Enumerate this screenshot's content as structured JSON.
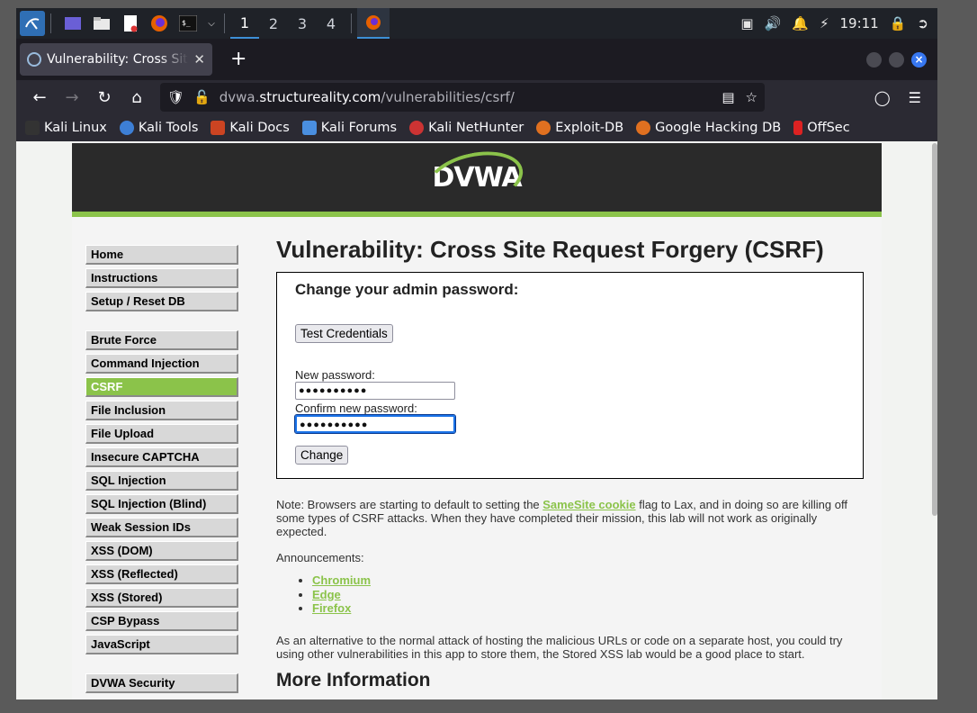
{
  "taskbar": {
    "workspaces": [
      "1",
      "2",
      "3",
      "4"
    ],
    "active_workspace": "1",
    "clock": "19:11"
  },
  "browser": {
    "tab_title": "Vulnerability: Cross Site Request Forgery (CSRF)",
    "url_prefix": "dvwa.",
    "url_host": "structureality.com",
    "url_path": "/vulnerabilities/csrf/",
    "bookmarks": [
      "Kali Linux",
      "Kali Tools",
      "Kali Docs",
      "Kali Forums",
      "Kali NetHunter",
      "Exploit-DB",
      "Google Hacking DB",
      "OffSec"
    ]
  },
  "dvwa": {
    "logo": "DVWA",
    "menu": {
      "home": "Home",
      "instructions": "Instructions",
      "setup": "Setup / Reset DB",
      "brute": "Brute Force",
      "cmd": "Command Injection",
      "csrf": "CSRF",
      "fi": "File Inclusion",
      "fu": "File Upload",
      "captcha": "Insecure CAPTCHA",
      "sqli": "SQL Injection",
      "sqlib": "SQL Injection (Blind)",
      "wsi": "Weak Session IDs",
      "xssd": "XSS (DOM)",
      "xssr": "XSS (Reflected)",
      "xsss": "XSS (Stored)",
      "csp": "CSP Bypass",
      "js": "JavaScript",
      "sec": "DVWA Security"
    },
    "page_title": "Vulnerability: Cross Site Request Forgery (CSRF)",
    "form": {
      "heading": "Change your admin password:",
      "test_button": "Test Credentials",
      "new_label": "New password:",
      "new_value": "●●●●●●●●●●",
      "confirm_label": "Confirm new password:",
      "confirm_value": "●●●●●●●●●●",
      "change_button": "Change"
    },
    "note_prefix": "Note: Browsers are starting to default to setting the ",
    "note_link": "SameSite cookie",
    "note_suffix": " flag to Lax, and in doing so are killing off some types of CSRF attacks. When they have completed their mission, this lab will not work as originally expected.",
    "announcements_label": "Announcements:",
    "announcements": [
      "Chromium",
      "Edge",
      "Firefox"
    ],
    "alt_text": "As an alternative to the normal attack of hosting the malicious URLs or code on a separate host, you could try using other vulnerabilities in this app to store them, the Stored XSS lab would be a good place to start.",
    "more_info": "More Information"
  },
  "colors": {
    "accent": "#8bc34a",
    "taskbar": "#1f2228",
    "browser_chrome": "#2b2a33"
  }
}
